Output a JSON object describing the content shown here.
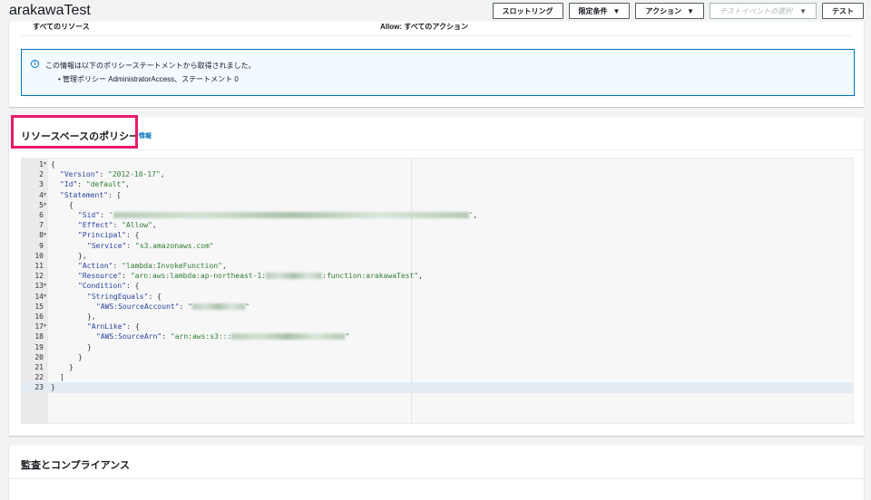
{
  "header": {
    "title": "arakawaTest",
    "buttons": {
      "throttle": "スロットリング",
      "qualifiers": "限定条件",
      "actions": "アクション",
      "test_event_placeholder": "テストイベントの選択",
      "test": "テスト"
    }
  },
  "permissions": {
    "resource": "すべてのリソース",
    "action": "Allow: すべてのアクション",
    "info_text": "この情報は以下のポリシーステートメントから取得されました。",
    "info_item": "管理ポリシー AdministratorAccess、ステートメント 0"
  },
  "resource_policy": {
    "title": "リソースベースのポリシー",
    "info_link": "情報",
    "lines": [
      {
        "n": "1",
        "fold": true,
        "indent": 0,
        "parts": [
          [
            "{",
            "p"
          ]
        ]
      },
      {
        "n": "2",
        "indent": 1,
        "parts": [
          [
            "\"Version\"",
            "k"
          ],
          [
            ": ",
            "p"
          ],
          [
            "\"2012-10-17\"",
            "s"
          ],
          [
            ",",
            "p"
          ]
        ]
      },
      {
        "n": "3",
        "indent": 1,
        "parts": [
          [
            "\"Id\"",
            "k"
          ],
          [
            ": ",
            "p"
          ],
          [
            "\"default\"",
            "s"
          ],
          [
            ",",
            "p"
          ]
        ]
      },
      {
        "n": "4",
        "fold": true,
        "indent": 1,
        "parts": [
          [
            "\"Statement\"",
            "k"
          ],
          [
            ": [",
            "p"
          ]
        ]
      },
      {
        "n": "5",
        "fold": true,
        "indent": 2,
        "parts": [
          [
            "{",
            "p"
          ]
        ]
      },
      {
        "n": "6",
        "indent": 3,
        "parts": [
          [
            "\"Sid\"",
            "k"
          ],
          [
            ": ",
            "p"
          ],
          [
            "'",
            "s"
          ],
          [
            "#blur:392",
            "b"
          ],
          [
            "'",
            "s"
          ],
          [
            ",",
            "p"
          ]
        ]
      },
      {
        "n": "7",
        "indent": 3,
        "parts": [
          [
            "\"Effect\"",
            "k"
          ],
          [
            ": ",
            "p"
          ],
          [
            "\"Allow\"",
            "s"
          ],
          [
            ",",
            "p"
          ]
        ]
      },
      {
        "n": "8",
        "fold": true,
        "indent": 3,
        "parts": [
          [
            "\"Principal\"",
            "k"
          ],
          [
            ": {",
            "p"
          ]
        ]
      },
      {
        "n": "9",
        "indent": 4,
        "parts": [
          [
            "\"Service\"",
            "k"
          ],
          [
            ": ",
            "p"
          ],
          [
            "\"s3.amazonaws.com\"",
            "s"
          ]
        ]
      },
      {
        "n": "10",
        "indent": 3,
        "parts": [
          [
            "},",
            "p"
          ]
        ]
      },
      {
        "n": "11",
        "indent": 3,
        "parts": [
          [
            "\"Action\"",
            "k"
          ],
          [
            ": ",
            "p"
          ],
          [
            "\"lambda:InvokeFunction\"",
            "s"
          ],
          [
            ",",
            "p"
          ]
        ]
      },
      {
        "n": "12",
        "indent": 3,
        "parts": [
          [
            "\"Resource\"",
            "k"
          ],
          [
            ": ",
            "p"
          ],
          [
            "\"arn:aws:lambda:ap-northeast-1:",
            "s"
          ],
          [
            "#blur:62",
            "b"
          ],
          [
            ":function:arakawaTest\"",
            "s"
          ],
          [
            ",",
            "p"
          ]
        ]
      },
      {
        "n": "13",
        "fold": true,
        "indent": 3,
        "parts": [
          [
            "\"Condition\"",
            "k"
          ],
          [
            ": {",
            "p"
          ]
        ]
      },
      {
        "n": "14",
        "fold": true,
        "indent": 4,
        "parts": [
          [
            "\"StringEquals\"",
            "k"
          ],
          [
            ": {",
            "p"
          ]
        ]
      },
      {
        "n": "15",
        "indent": 5,
        "parts": [
          [
            "\"AWS:SourceAccount\"",
            "k"
          ],
          [
            ": ",
            "p"
          ],
          [
            "\"",
            "s"
          ],
          [
            "#blur:58",
            "b"
          ],
          [
            "\"",
            "s"
          ]
        ]
      },
      {
        "n": "16",
        "indent": 4,
        "parts": [
          [
            "},",
            "p"
          ]
        ]
      },
      {
        "n": "17",
        "fold": true,
        "indent": 4,
        "parts": [
          [
            "\"ArnLike\"",
            "k"
          ],
          [
            ": {",
            "p"
          ]
        ]
      },
      {
        "n": "18",
        "indent": 5,
        "parts": [
          [
            "\"AWS:SourceArn\"",
            "k"
          ],
          [
            ": ",
            "p"
          ],
          [
            "\"arn:aws:s3:::",
            "s"
          ],
          [
            "#blur:125",
            "b"
          ],
          [
            "\"",
            "s"
          ]
        ]
      },
      {
        "n": "19",
        "indent": 4,
        "parts": [
          [
            "}",
            "p"
          ]
        ]
      },
      {
        "n": "20",
        "indent": 3,
        "parts": [
          [
            "}",
            "p"
          ]
        ]
      },
      {
        "n": "21",
        "indent": 2,
        "parts": [
          [
            "}",
            "p"
          ]
        ]
      },
      {
        "n": "22",
        "indent": 1,
        "parts": [
          [
            "]",
            "p"
          ]
        ]
      },
      {
        "n": "23",
        "indent": 0,
        "active": true,
        "parts": [
          [
            "}",
            "p"
          ]
        ]
      }
    ]
  },
  "audit": {
    "title": "監査とコンプライアンス"
  }
}
